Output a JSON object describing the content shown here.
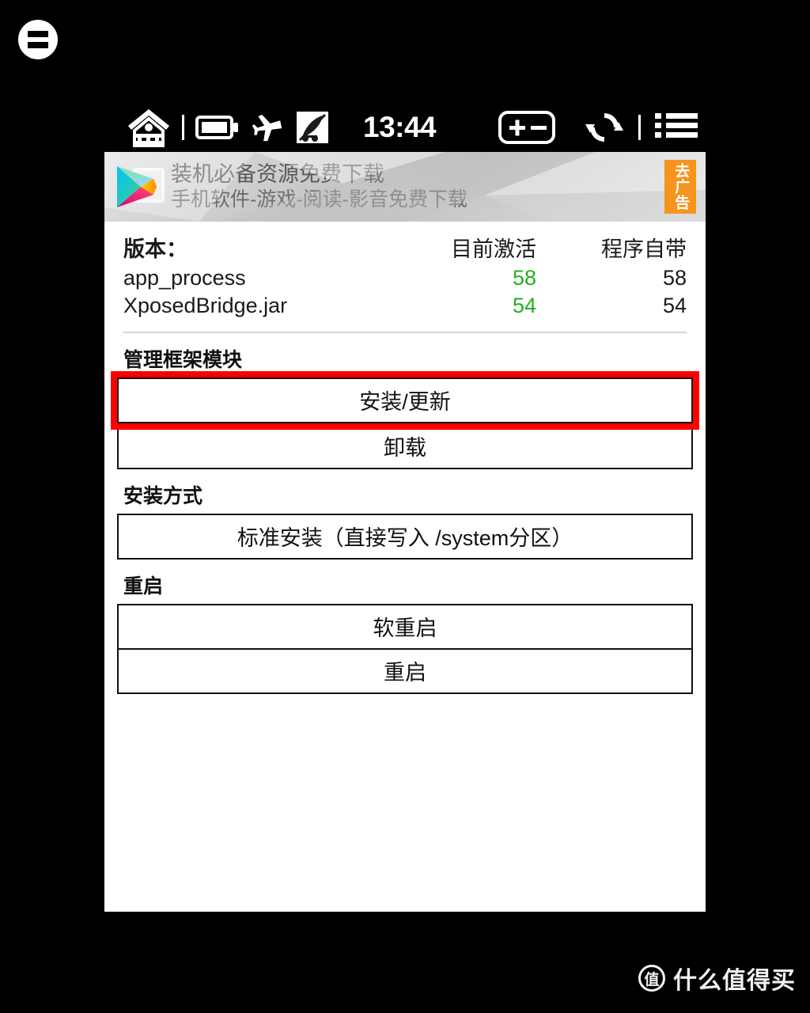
{
  "corner_badge": {
    "icon": "equals-circle-icon"
  },
  "statusbar": {
    "time": "13:44",
    "left_icons": [
      "home-fence-icon",
      "battery-icon",
      "airplane-mode-icon",
      "satellite-off-icon"
    ],
    "right_icons": [
      "zoom-plus-minus-icon",
      "refresh-sync-icon",
      "list-menu-icon"
    ]
  },
  "ad": {
    "title": "装机必备资源免费下载",
    "subtitle": "手机软件-游戏-阅读-影音免费下载",
    "badge_label": "去广告",
    "badge_color": "#f7941e",
    "logo": "google-play-icon"
  },
  "version": {
    "header": {
      "label": "版本：",
      "col_active": "目前激活",
      "col_builtin": "程序自带"
    },
    "rows": [
      {
        "name": "app_process",
        "active": "58",
        "builtin": "58"
      },
      {
        "name": "XposedBridge.jar",
        "active": "54",
        "builtin": "54"
      }
    ],
    "active_color": "#22b022"
  },
  "sections": [
    {
      "label": "管理框架模块",
      "buttons": [
        {
          "label": "安装/更新",
          "highlighted": true
        },
        {
          "label": "卸载",
          "highlighted": false
        }
      ]
    },
    {
      "label": "安装方式",
      "buttons": [
        {
          "label": "标准安装（直接写入 /system分区）",
          "highlighted": false
        }
      ]
    },
    {
      "label": "重启",
      "buttons": [
        {
          "label": "软重启",
          "highlighted": false
        },
        {
          "label": "重启",
          "highlighted": false
        }
      ]
    }
  ],
  "highlight": {
    "color": "#ff0000"
  },
  "watermark": {
    "mark": "值",
    "text": "什么值得买"
  }
}
